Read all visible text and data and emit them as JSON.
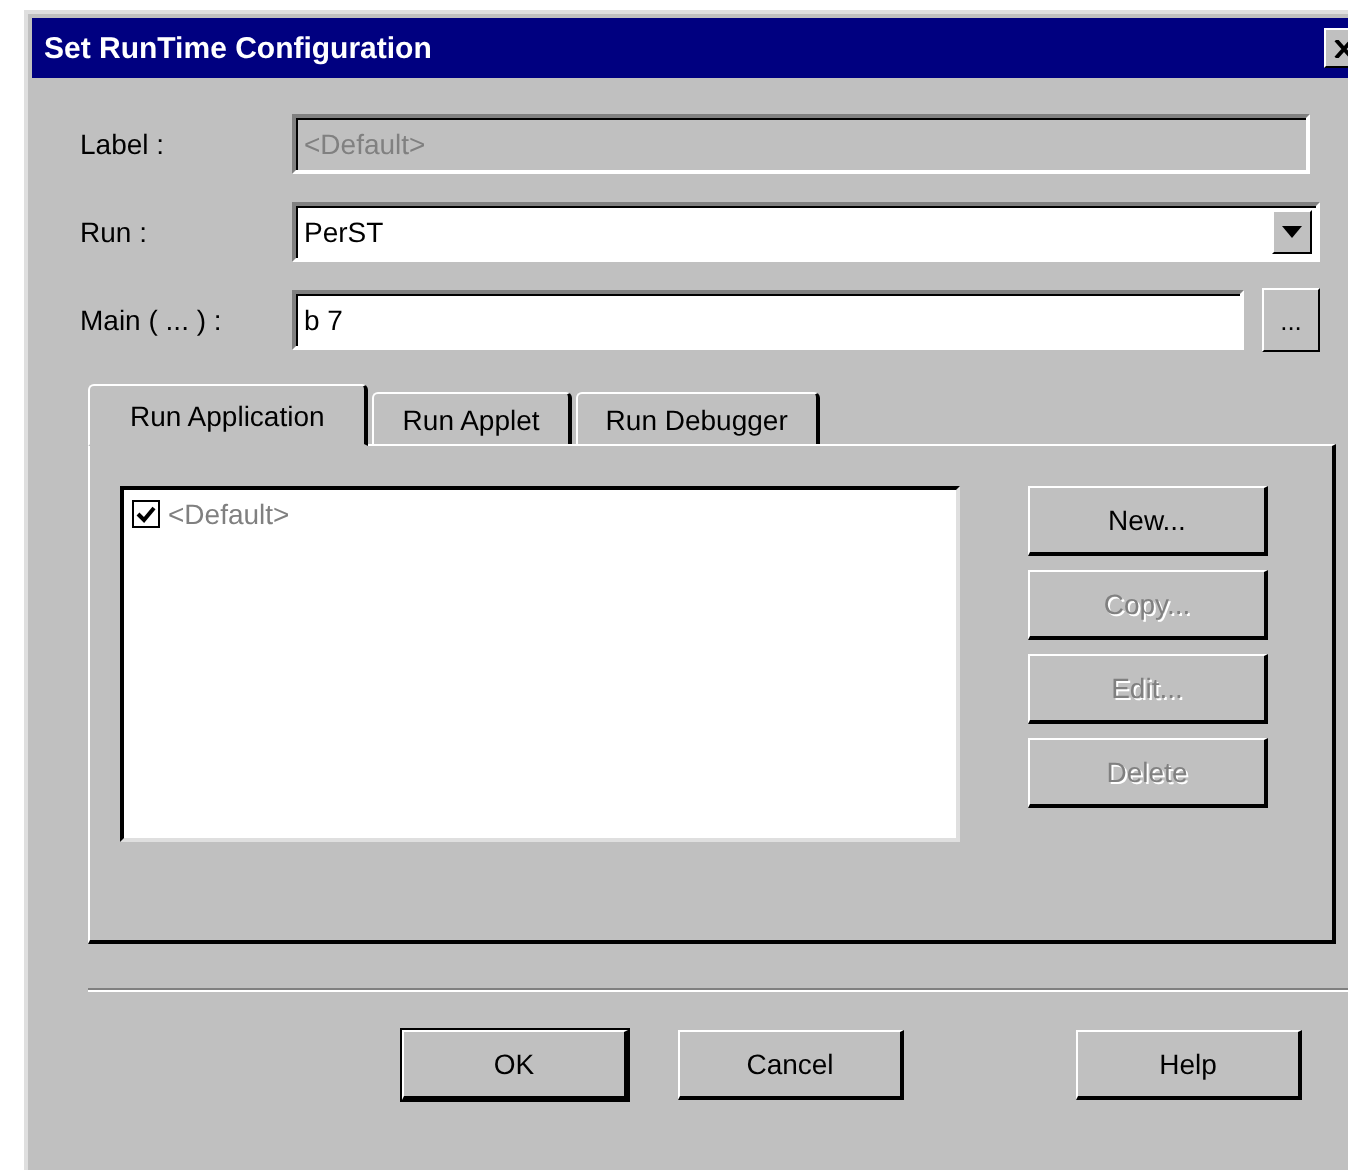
{
  "window": {
    "title": "Set RunTime Configuration"
  },
  "fields": [
    {
      "kind": "text",
      "label": "Label :",
      "value": "<Default>",
      "disabled": true
    },
    {
      "kind": "dropdown",
      "label": "Run :",
      "value": "PerST",
      "disabled": false
    },
    {
      "kind": "browse",
      "label": "Main ( ... ) :",
      "value": "b 7",
      "disabled": false,
      "button": "..."
    }
  ],
  "tabs": [
    {
      "label": "Run Application",
      "selected": true
    },
    {
      "label": "Run Applet",
      "selected": false
    },
    {
      "label": "Run Debugger",
      "selected": false
    }
  ],
  "list": [
    {
      "label": "<Default>",
      "checked": true,
      "disabled": true
    }
  ],
  "side_buttons": [
    {
      "label": "New...",
      "disabled": false
    },
    {
      "label": "Copy...",
      "disabled": true
    },
    {
      "label": "Edit...",
      "disabled": true
    },
    {
      "label": "Delete",
      "disabled": true
    }
  ],
  "footer_buttons": [
    {
      "label": "OK",
      "default": true
    },
    {
      "label": "Cancel",
      "default": false
    },
    {
      "label": "Help",
      "default": false
    }
  ]
}
